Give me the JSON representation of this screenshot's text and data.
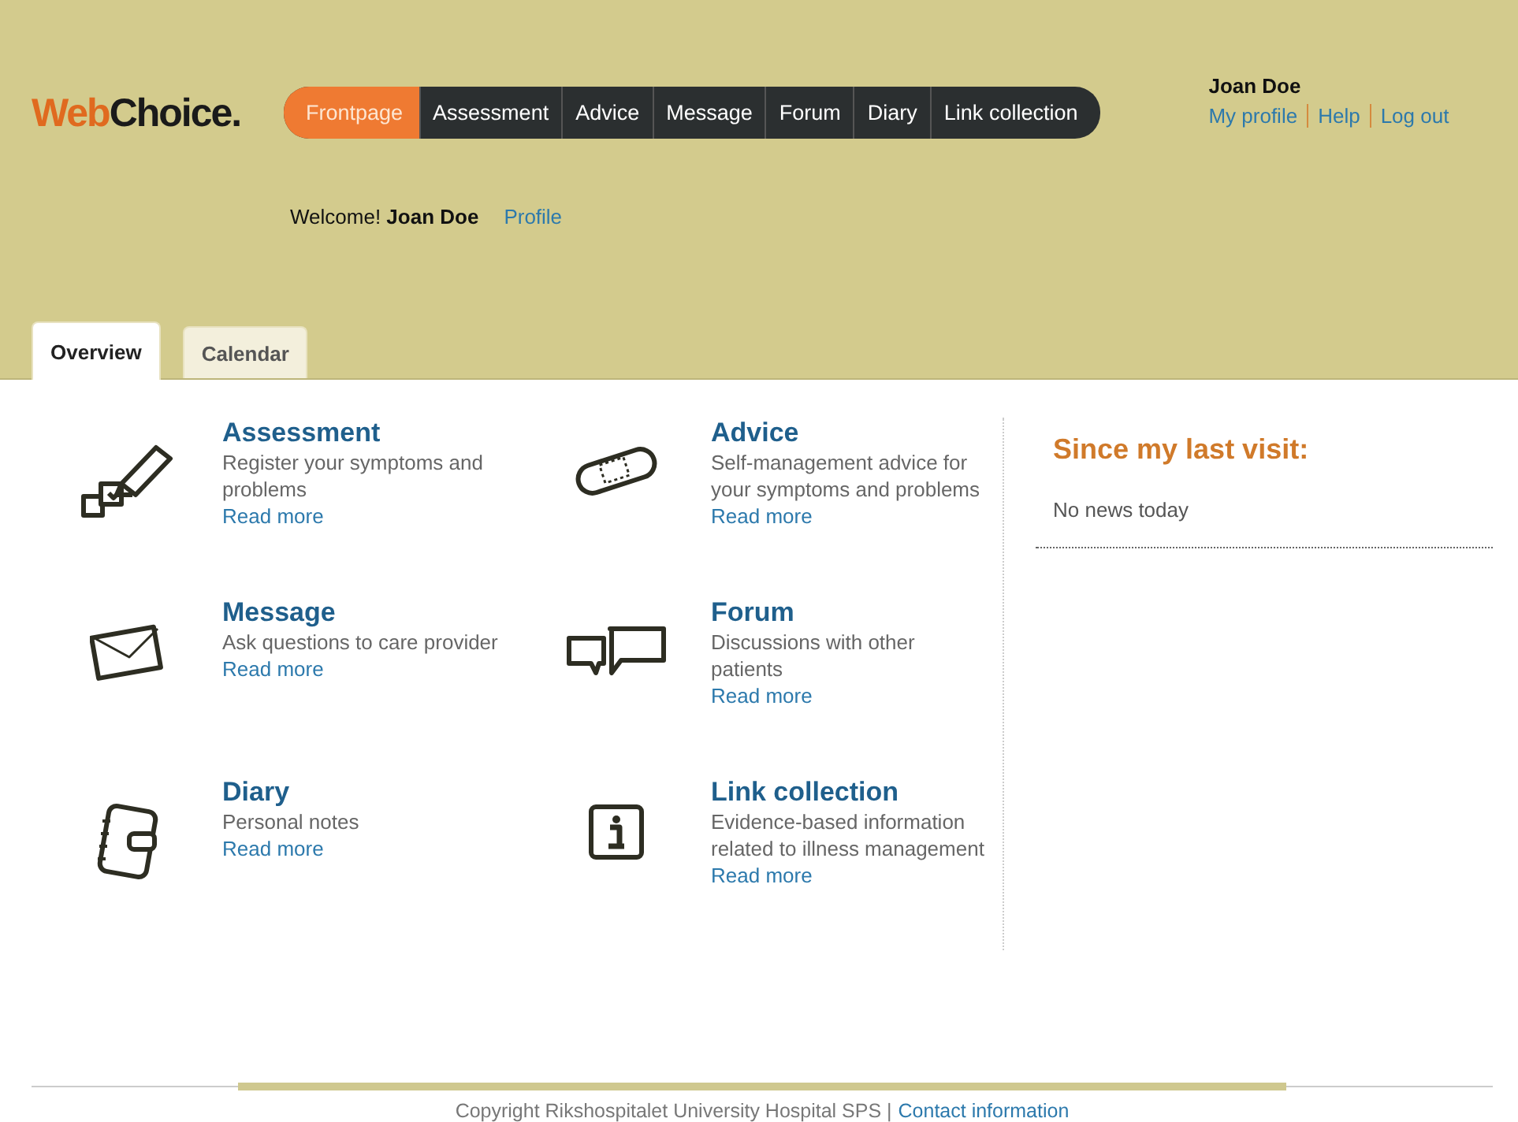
{
  "logo": {
    "first": "Web",
    "second": "Choice."
  },
  "nav": [
    {
      "label": "Frontpage",
      "selected": true
    },
    {
      "label": "Assessment",
      "selected": false
    },
    {
      "label": "Advice",
      "selected": false
    },
    {
      "label": "Message",
      "selected": false
    },
    {
      "label": "Forum",
      "selected": false
    },
    {
      "label": "Diary",
      "selected": false
    },
    {
      "label": "Link collection",
      "selected": false
    }
  ],
  "user": {
    "name": "Joan Doe",
    "links": [
      "My profile",
      "Help",
      "Log out"
    ]
  },
  "welcome": {
    "text": "Welcome! **Joan Doe**",
    "link": "Profile"
  },
  "tabs": [
    {
      "label": "Overview",
      "selected": true
    },
    {
      "label": "Calendar",
      "selected": false
    }
  ],
  "features": [
    {
      "kind": "assessment",
      "title": "Assessment",
      "text": "Register your symptoms and problems",
      "link": "Read more"
    },
    {
      "kind": "advice",
      "title": "Advice",
      "text": "Self-management advice for your symptoms and problems",
      "link": "Read more"
    },
    {
      "kind": "message",
      "title": "Message",
      "text": "Ask questions to care provider",
      "link": "Read more"
    },
    {
      "kind": "forum",
      "title": "Forum",
      "text": "Discussions with other patients",
      "link": "Read more"
    },
    {
      "kind": "diary",
      "title": "Diary",
      "text": "Personal notes",
      "link": "Read more"
    },
    {
      "kind": "info",
      "title": "Link collection",
      "text": "Evidence-based information related to illness management",
      "link": "Read more"
    }
  ],
  "news": {
    "title": "Since my last visit:",
    "text": "No news today"
  },
  "footer": {
    "text": "Copyright Rikshospitalet University Hospital SPS |",
    "link": "Contact information"
  }
}
